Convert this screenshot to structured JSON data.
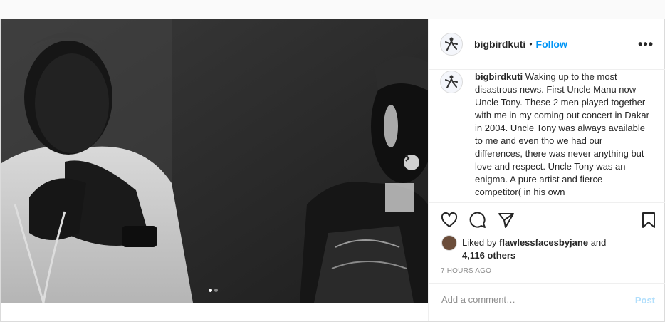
{
  "post": {
    "username": "bigbirdkuti",
    "separator": "•",
    "follow_label": "Follow",
    "more_label": "•••",
    "caption": "Waking up to the most disastrous news. First Uncle Manu now Uncle Tony. These 2 men played together with me in my coming out concert in Dakar in 2004. Uncle Tony was always available to me and even tho we had our differences, there was never anything but love and respect. Uncle Tony was an enigma. A pure artist and fierce competitor( in his own",
    "likes": {
      "prefix": "Liked by ",
      "user": "flawlessfacesbyjane",
      "middle": " and",
      "count": "4,116 others"
    },
    "time_ago": "7 HOURS AGO",
    "comment_placeholder": "Add a comment…",
    "post_label": "Post",
    "carousel": {
      "total": 2,
      "active": 1
    }
  }
}
